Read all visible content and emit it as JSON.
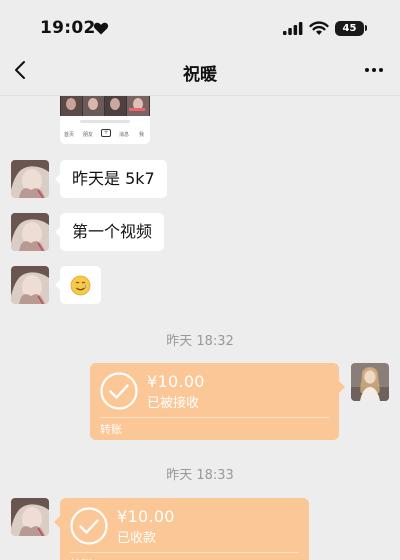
{
  "status_bar": {
    "time": "19:02",
    "battery": "45"
  },
  "nav": {
    "title": "祝暖"
  },
  "shared_card": {
    "tabs": [
      "首页",
      "朋友",
      "+",
      "消息",
      "我"
    ]
  },
  "messages": [
    {
      "text": "昨天是 5k7"
    },
    {
      "text": "第一个视频"
    },
    {
      "emoji": "🥲"
    }
  ],
  "timestamps": [
    "昨天 18:32",
    "昨天 18:33"
  ],
  "transfers": [
    {
      "amount": "¥10.00",
      "status": "已被接收",
      "label": "转账"
    },
    {
      "amount": "¥10.00",
      "status": "已收款",
      "label": "转账"
    }
  ],
  "colors": {
    "transfer_bg": "#fbc797",
    "background": "#ededed"
  }
}
